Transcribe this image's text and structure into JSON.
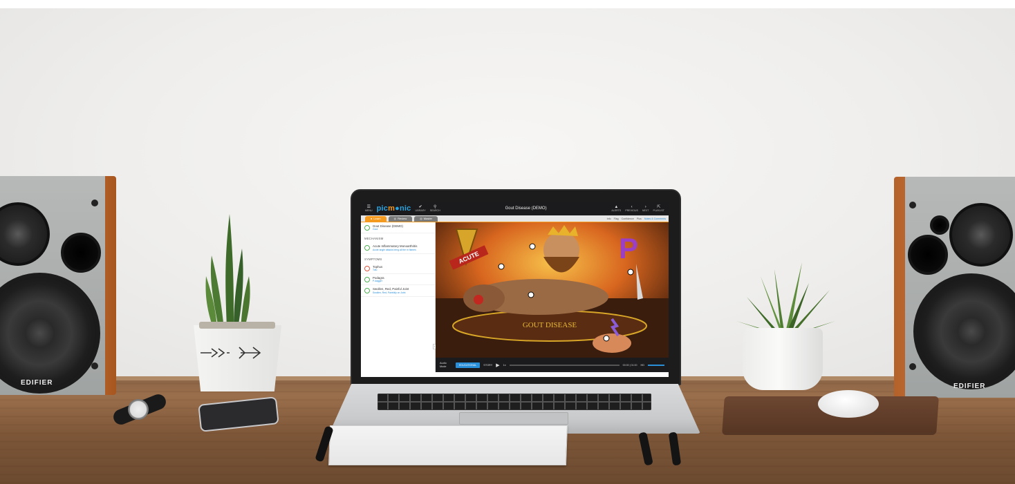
{
  "app": {
    "brand_logo_prefix": "pic",
    "brand_logo_accent": "m",
    "brand_logo_suffix": "nic",
    "window_title": "Gout Disease (DEMO)",
    "nav_left": [
      {
        "icon": "menu-icon",
        "label": "MENU"
      },
      {
        "icon": "library-icon",
        "label": "LIBRARY"
      },
      {
        "icon": "search-icon",
        "label": "SEARCH"
      }
    ],
    "nav_right": [
      {
        "icon": "bell-icon",
        "label": "ALERTS"
      },
      {
        "icon": "chevron-left-icon",
        "label": "PREVIOUS"
      },
      {
        "icon": "chevron-right-icon",
        "label": "NEXT"
      },
      {
        "icon": "collapse-icon",
        "label": "PLAYLIST"
      }
    ],
    "tabs": [
      {
        "label": "Learn",
        "active": true
      },
      {
        "label": "Review",
        "active": false
      },
      {
        "label": "Master",
        "active": false
      }
    ],
    "toolbar": {
      "item1": "Info",
      "item2": "Flag",
      "item3": "Confidence",
      "item4": "Plus",
      "item5": "Notes & Comments"
    },
    "sidebar": {
      "top_item": {
        "title": "Gout Disease (DEMO)",
        "subtitle": "Gout"
      },
      "section_mechanism": "MECHANISM",
      "mechanism_item": {
        "title": "Acute Inflammatory Monoarthritis",
        "subtitle": "Acute angle attacks bring all the m flames"
      },
      "section_symptoms": "SYMPTOMS",
      "symptom_items": [
        {
          "title": "Tophus",
          "subtitle": "Tofu",
          "state": "red"
        },
        {
          "title": "Podagra",
          "subtitle": "P-dagger",
          "state": "green"
        },
        {
          "title": "Swollen, Red, Painful Joint",
          "subtitle": "Swollen, Red, Painfully on Joint",
          "state": "green"
        }
      ]
    },
    "player": {
      "audio_mode_label": "Audio Mode",
      "mode_button": "EDUCATIONAL",
      "story_label": "STORY",
      "play_icon": "play-icon",
      "speed_label": "1x",
      "time": "00:00 | 01:00",
      "hd_label": "HD"
    },
    "art_labels": {
      "acute": "ACUTE",
      "gout": "GOUT DISEASE",
      "p": "P"
    }
  },
  "speakers": {
    "brand": "EDIFIER"
  },
  "colors": {
    "brand_blue": "#2aa4e0",
    "brand_orange": "#f39a1f",
    "speaker_wood": "#c8703a",
    "desk": "#8a6446"
  }
}
